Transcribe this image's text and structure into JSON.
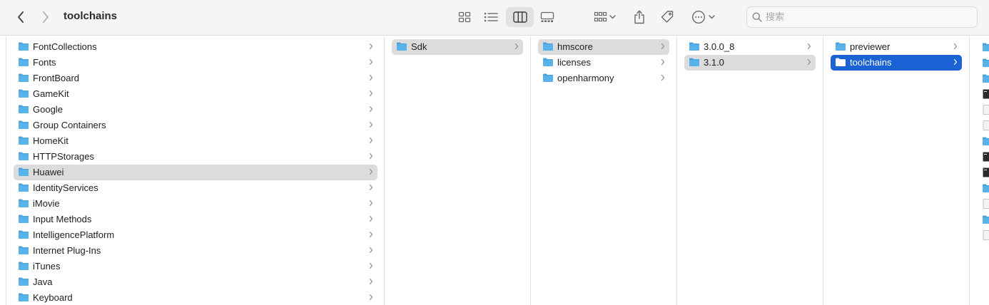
{
  "window": {
    "title": "toolchains"
  },
  "toolbar": {
    "back_icon": "chevron-left-icon",
    "forward_icon": "chevron-right-icon",
    "view_modes": [
      "icon-view-icon",
      "list-view-icon",
      "column-view-icon",
      "gallery-view-icon"
    ],
    "active_view": "column-view-icon",
    "group_icon": "group-by-icon",
    "share_icon": "share-icon",
    "tag_icon": "tag-icon",
    "more_icon": "ellipsis-circle-icon"
  },
  "search": {
    "placeholder": "搜索",
    "value": ""
  },
  "colors": {
    "folder": "#58b3ea",
    "folder_tab": "#4aa3dc",
    "selected_blue": "#1a62d6",
    "selected_gray": "#dcdcdc",
    "toolbar_bg": "#f6f4f4"
  },
  "columns": [
    {
      "items": [
        {
          "name": "FontCollections",
          "has_children": true,
          "state": "none"
        },
        {
          "name": "Fonts",
          "has_children": true,
          "state": "none"
        },
        {
          "name": "FrontBoard",
          "has_children": true,
          "state": "none"
        },
        {
          "name": "GameKit",
          "has_children": true,
          "state": "none"
        },
        {
          "name": "Google",
          "has_children": true,
          "state": "none"
        },
        {
          "name": "Group Containers",
          "has_children": true,
          "state": "none"
        },
        {
          "name": "HomeKit",
          "has_children": true,
          "state": "none"
        },
        {
          "name": "HTTPStorages",
          "has_children": true,
          "state": "none"
        },
        {
          "name": "Huawei",
          "has_children": true,
          "state": "selected-inactive"
        },
        {
          "name": "IdentityServices",
          "has_children": true,
          "state": "none"
        },
        {
          "name": "iMovie",
          "has_children": true,
          "state": "none"
        },
        {
          "name": "Input Methods",
          "has_children": true,
          "state": "none"
        },
        {
          "name": "IntelligencePlatform",
          "has_children": true,
          "state": "none"
        },
        {
          "name": "Internet Plug-Ins",
          "has_children": true,
          "state": "none"
        },
        {
          "name": "iTunes",
          "has_children": true,
          "state": "none"
        },
        {
          "name": "Java",
          "has_children": true,
          "state": "none"
        },
        {
          "name": "Keyboard",
          "has_children": true,
          "state": "none"
        }
      ]
    },
    {
      "items": [
        {
          "name": "Sdk",
          "has_children": true,
          "state": "selected-inactive"
        }
      ]
    },
    {
      "items": [
        {
          "name": "hmscore",
          "has_children": true,
          "state": "selected-inactive"
        },
        {
          "name": "licenses",
          "has_children": true,
          "state": "none"
        },
        {
          "name": "openharmony",
          "has_children": true,
          "state": "none"
        }
      ]
    },
    {
      "items": [
        {
          "name": "3.0.0_8",
          "has_children": true,
          "state": "none"
        },
        {
          "name": "3.1.0",
          "has_children": true,
          "state": "selected-inactive"
        }
      ]
    },
    {
      "items": [
        {
          "name": "previewer",
          "has_children": true,
          "state": "none"
        },
        {
          "name": "toolchains",
          "has_children": true,
          "state": "selected-active"
        }
      ]
    }
  ],
  "next_column_partial_icons": [
    "folder-icon",
    "folder-icon",
    "folder-icon",
    "terminal-file-icon",
    "document-icon",
    "document-icon",
    "folder-icon",
    "terminal-file-icon",
    "terminal-file-icon",
    "folder-icon",
    "document-icon",
    "folder-icon",
    "document-icon"
  ]
}
